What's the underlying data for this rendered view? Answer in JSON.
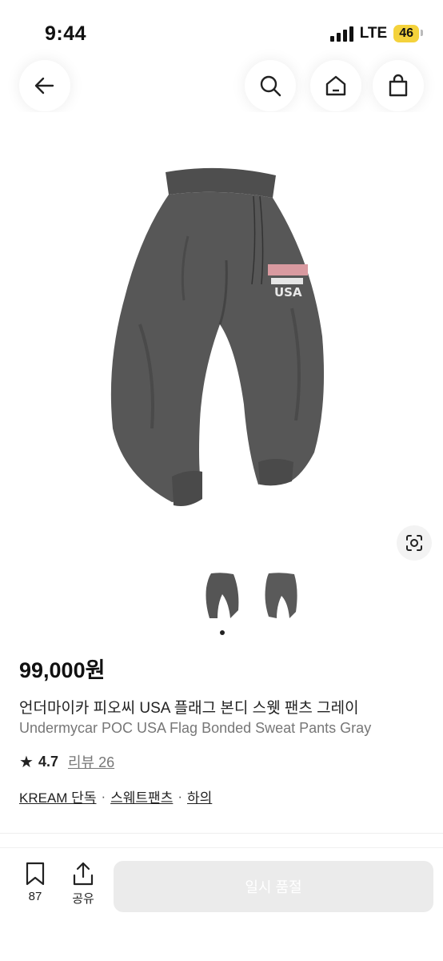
{
  "status_bar": {
    "time": "9:44",
    "network": "LTE",
    "battery": "46"
  },
  "header": {
    "back_icon": "arrow-left-icon",
    "search_icon": "search-icon",
    "home_icon": "home-icon",
    "bag_icon": "shopping-bag-icon"
  },
  "product": {
    "image_desc_icon": "product-image",
    "price": "99,000원",
    "name_ko": "언더마이카 피오씨 USA 플래그 본디 스웻 팬츠 그레이",
    "name_en": "Undermycar POC USA Flag Bonded Sweat Pants Gray",
    "rating": "4.7",
    "reviews_label": "리뷰 26",
    "tags": [
      "KREAM 단독",
      "스웨트팬츠",
      "하의"
    ],
    "tag_separator": "·"
  },
  "gallery": {
    "thumbnail_count": 2,
    "active_index": 0
  },
  "bottom_bar": {
    "wishlist_count": "87",
    "share_label": "공유",
    "buy_button_label": "일시 품절"
  },
  "colors": {
    "pants": "#555555",
    "battery": "#f4d23c",
    "disabled_button": "#ebebeb"
  }
}
